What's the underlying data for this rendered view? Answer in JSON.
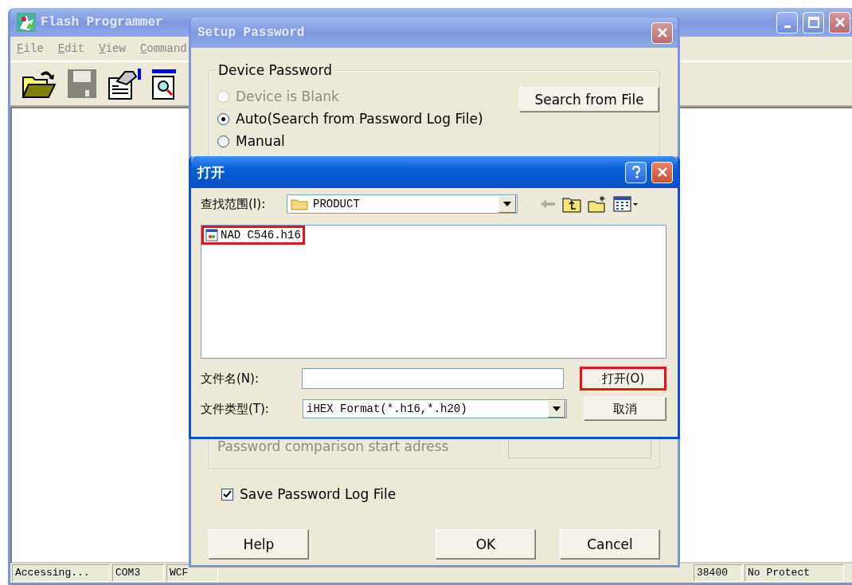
{
  "main_window": {
    "title": "Flash Programmer",
    "menu": [
      {
        "label": "File"
      },
      {
        "label": "Edit"
      },
      {
        "label": "View"
      },
      {
        "label": "Command"
      }
    ],
    "toolbar": [
      {
        "kind": "open",
        "disabled": false
      },
      {
        "kind": "save",
        "disabled": true
      },
      {
        "kind": "properties",
        "disabled": false
      },
      {
        "kind": "inspect",
        "disabled": false
      }
    ],
    "status_bar": [
      "Accessing...",
      "COM3",
      "WCF",
      "38400",
      "No Protect"
    ]
  },
  "setup_dialog": {
    "title": "Setup Password",
    "group": "Device Password",
    "options": [
      {
        "label": "Device is Blank",
        "selected": false,
        "disabled": true
      },
      {
        "label": "Auto(Search from Password Log File)",
        "selected": true,
        "disabled": false
      },
      {
        "label": "Manual",
        "selected": false,
        "disabled": false
      }
    ],
    "search_button": "Search from File",
    "address_group": {
      "label": "Password comparison start adress",
      "disabled": true
    },
    "save_log": {
      "label": "Save Password Log File",
      "checked": true
    },
    "buttons": [
      "Help",
      "OK",
      "Cancel"
    ]
  },
  "open_dialog": {
    "title": "打开",
    "look_in_label": "查找范围(I):",
    "look_in": "PRODUCT",
    "files": [
      {
        "name": "NAD C546.h16",
        "highlighted": true
      }
    ],
    "file_name_label": "文件名(N):",
    "file_type_label": "文件类型(T):",
    "file_type": "iHEX Format(*.h16,*.h20)",
    "buttons": [
      {
        "label": "打开(O)",
        "highlighted": true
      },
      {
        "label": "取消",
        "highlighted": false
      }
    ]
  }
}
